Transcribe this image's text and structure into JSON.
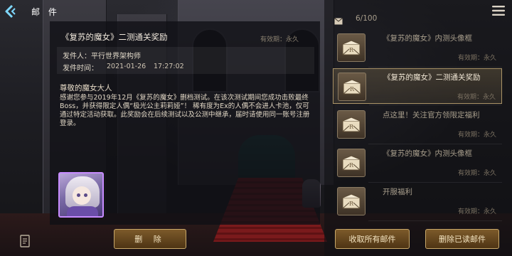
{
  "header": {
    "title": "邮 件"
  },
  "detail": {
    "title": "《复苏的魔女》二测通关奖励",
    "validity": "有效期：永久",
    "sender_line": "发件人：平行世界架构师",
    "send_time_label": "发件时间：",
    "send_date": "2021-01-26",
    "send_time": "17:27:02",
    "greeting": "尊敬的魔女大人",
    "body": "感谢您参与2019年12月《复苏的魔女》删档测试。在该次测试期间您成功击败最终Boss，并获得限定人偶“极光公主莉莉娅”！ 稀有度为Ex的人偶不会进人卡池，仅可通过特定活动获取。此奖励会在后续测试以及公测中继承，届时请使用同一账号注册登录。",
    "delete_label": "删 除"
  },
  "list": {
    "count": "6/100",
    "items": [
      {
        "subject": "《复苏的魔女》内测头像框",
        "expiry": "有效期：永久",
        "state": "read"
      },
      {
        "subject": "《复苏的魔女》二测通关奖励",
        "expiry": "有效期：永久",
        "state": "selected"
      },
      {
        "subject": "点这里！关注官方领限定福利",
        "expiry": "有效期：永久",
        "state": "read"
      },
      {
        "subject": "《复苏的魔女》内测头像框",
        "expiry": "有效期：永久",
        "state": "read"
      },
      {
        "subject": "开服福利",
        "expiry": "有效期：永久",
        "state": "read"
      }
    ],
    "collect_all_label": "收取所有邮件",
    "remove_read_label": "删除已读邮件"
  },
  "icons": {
    "back": "back-arrow-icon",
    "menu": "hamburger-menu-icon",
    "envelope": "envelope-icon",
    "mail_thumb": "open-envelope-icon",
    "notes": "notes-icon"
  },
  "colors": {
    "accent_gold": "#c8a86a",
    "button_bg": "#6a4a22",
    "back_cyan": "#7fd8ff",
    "reward_border": "#c78bff"
  }
}
